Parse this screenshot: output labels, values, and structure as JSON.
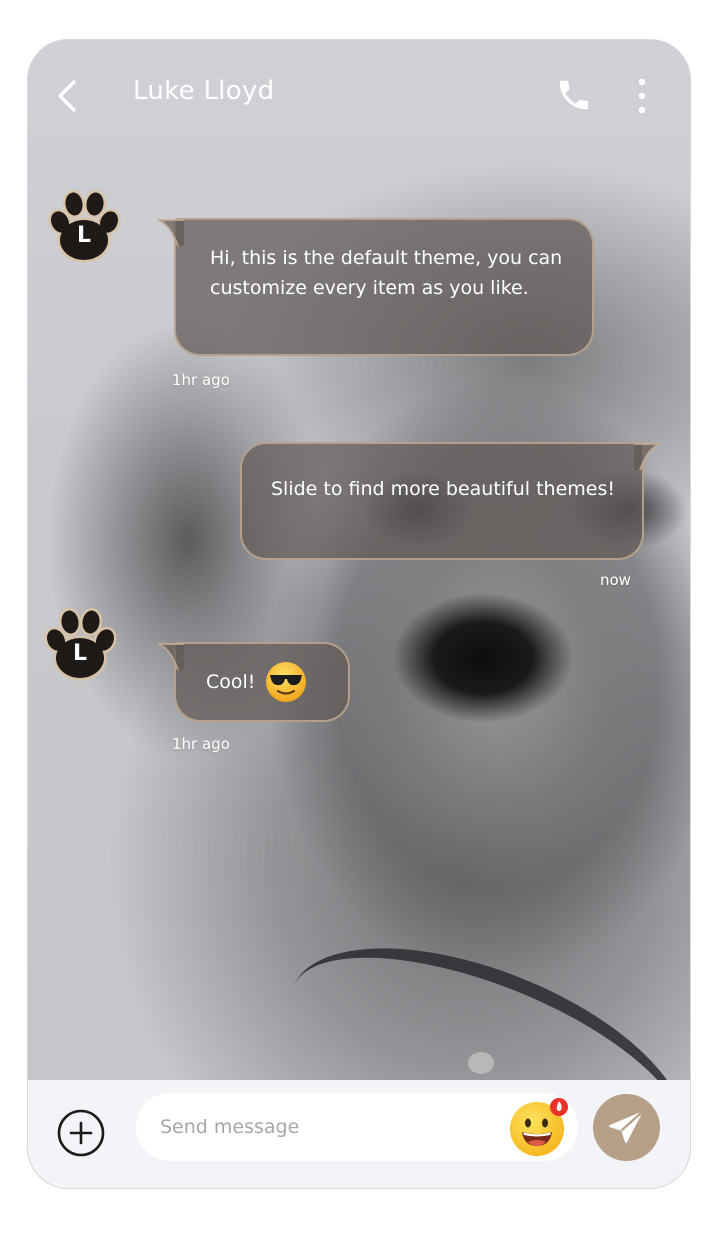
{
  "header": {
    "title": "Luke Lloyd",
    "back_icon": "chevron-left-icon",
    "call_icon": "phone-icon",
    "more_icon": "more-vertical-icon"
  },
  "messages": [
    {
      "sender": "incoming",
      "avatar_initial": "L",
      "avatar_icon": "paw-icon",
      "text": "Hi, this is the default theme, you can customize every item as you like.",
      "time": "1hr ago"
    },
    {
      "sender": "outgoing",
      "text": "Slide to find more beautiful themes!",
      "time": "now"
    },
    {
      "sender": "incoming",
      "avatar_initial": "L",
      "avatar_icon": "paw-icon",
      "text": "Cool!",
      "emoji": "sunglasses-emoji",
      "time": "1hr ago"
    }
  ],
  "composer": {
    "placeholder": "Send message",
    "value": "",
    "add_icon": "plus-circle-icon",
    "emoji_icon": "grinning-face-emoji-icon",
    "send_icon": "paper-plane-icon"
  },
  "colors": {
    "bubble_fill": "#605a58",
    "bubble_border": "#c2aa94",
    "send_button": "#b79e87",
    "input_bar": "#f2f4f7",
    "avatar_paw": "#1e1a18",
    "avatar_ring": "#e9d9c4"
  }
}
